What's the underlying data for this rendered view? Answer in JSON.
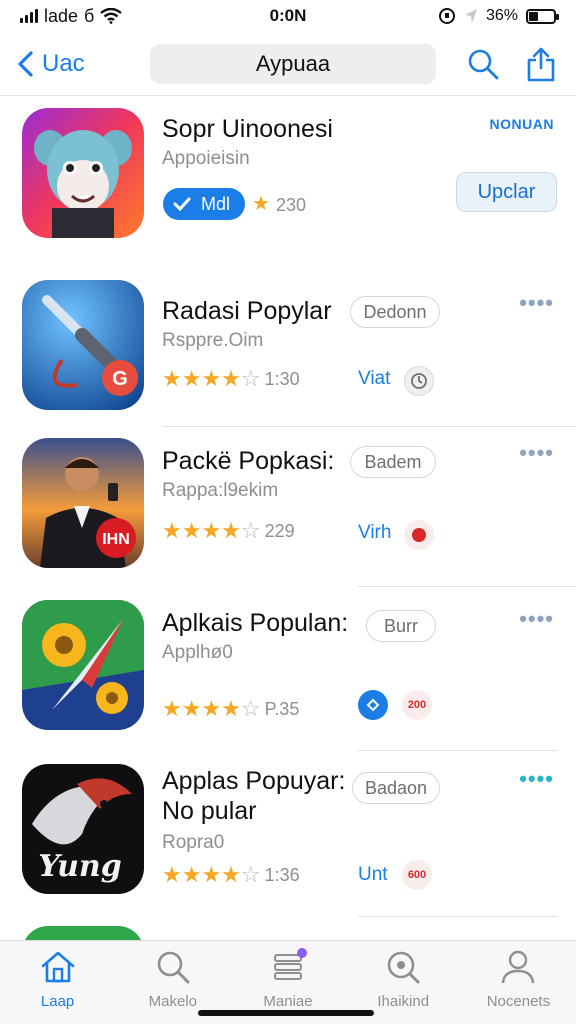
{
  "status_bar": {
    "carrier": "lade",
    "network": "б",
    "time": "0:0Ν",
    "battery_percent": "36%",
    "battery_level": 0.36
  },
  "nav": {
    "back_label": "Uac",
    "title": "Aypuaa",
    "icons": [
      "search-icon",
      "share-icon"
    ]
  },
  "apps": [
    {
      "name": "Sopr Uinoonesi",
      "subtitle": "Appoieisin",
      "badge_label": "Mdl",
      "rating_text": "230",
      "corner_label": "NONUAN",
      "action_label": "Upclar"
    },
    {
      "name": "Radasi Popylar",
      "subtitle": "Rsppre.Oim",
      "stars": 4,
      "rating_text": "1:30",
      "pill_label": "Dedonn",
      "link_label": "Viat",
      "more": "••••"
    },
    {
      "name": "Packë Popkasi:",
      "subtitle": "Rappa:l9ekim",
      "stars": 4,
      "rating_text": "229",
      "pill_label": "Badem",
      "link_label": "Virh",
      "more": "••••"
    },
    {
      "name": "Aplkais Populan:",
      "subtitle": "Applhø0",
      "stars": 4,
      "rating_text": "P.35",
      "pill_label": "Burr",
      "badge_small_label": "200",
      "more": "••••"
    },
    {
      "name_line1": "Applas Popuyar:",
      "name_line2": "No pular",
      "subtitle": "Ropra0",
      "stars": 4,
      "rating_text": "1:36",
      "pill_label": "Badaon",
      "link_label": "Unt",
      "badge_small_label": "600",
      "more": "••••"
    }
  ],
  "tab_bar": {
    "tabs": [
      {
        "label": "Laap",
        "icon": "home-icon",
        "active": true
      },
      {
        "label": "Makelo",
        "icon": "search-icon",
        "active": false
      },
      {
        "label": "Maniae",
        "icon": "stack-icon",
        "active": false
      },
      {
        "label": "Ihaikind",
        "icon": "magnifier-icon",
        "active": false
      },
      {
        "label": "Nocenets",
        "icon": "person-icon",
        "active": false
      }
    ]
  },
  "colors": {
    "accent": "#1a7ee6",
    "star": "#f5a623",
    "nav_title_bg": "#eceef0"
  }
}
